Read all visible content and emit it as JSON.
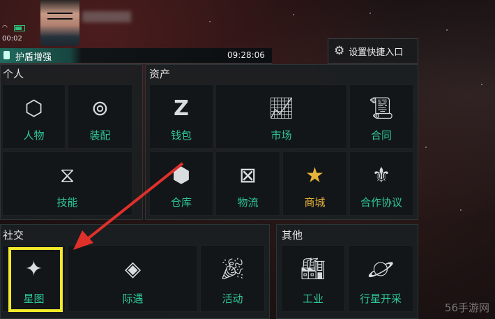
{
  "status": {
    "time": "00:02"
  },
  "shield": {
    "label": "护盾增强",
    "timer": "09:28:06"
  },
  "quick_entry": {
    "label": "设置快捷入口",
    "icon": "gear-icon"
  },
  "sections": {
    "personal": {
      "title": "个人",
      "items": [
        {
          "label": "人物",
          "icon": "vitruvian-icon"
        },
        {
          "label": "装配",
          "icon": "equipment-icon"
        },
        {
          "label": "技能",
          "icon": "dna-icon"
        }
      ]
    },
    "assets": {
      "title": "资产",
      "items": [
        {
          "label": "钱包",
          "icon": "wallet-z-icon"
        },
        {
          "label": "市场",
          "icon": "chart-icon"
        },
        {
          "label": "合同",
          "icon": "scroll-icon"
        },
        {
          "label": "仓库",
          "icon": "cube-icon"
        },
        {
          "label": "物流",
          "icon": "crate-icon"
        },
        {
          "label": "商城",
          "icon": "nes-star-icon"
        },
        {
          "label": "合作协议",
          "icon": "alliance-icon"
        }
      ]
    },
    "social": {
      "title": "社交",
      "items": [
        {
          "label": "星图",
          "icon": "star-map-icon"
        },
        {
          "label": "际遇",
          "icon": "encounter-icon"
        },
        {
          "label": "活动",
          "icon": "party-popper-icon"
        }
      ]
    },
    "other": {
      "title": "其他",
      "items": [
        {
          "label": "工业",
          "icon": "factory-icon"
        },
        {
          "label": "行星开采",
          "icon": "planet-icon"
        }
      ]
    }
  },
  "watermark": "56手游网",
  "colors": {
    "label": "#2ec799",
    "shop_label": "#e6b23c",
    "highlight": "#f2ea2a",
    "arrow": "#e0302a"
  }
}
